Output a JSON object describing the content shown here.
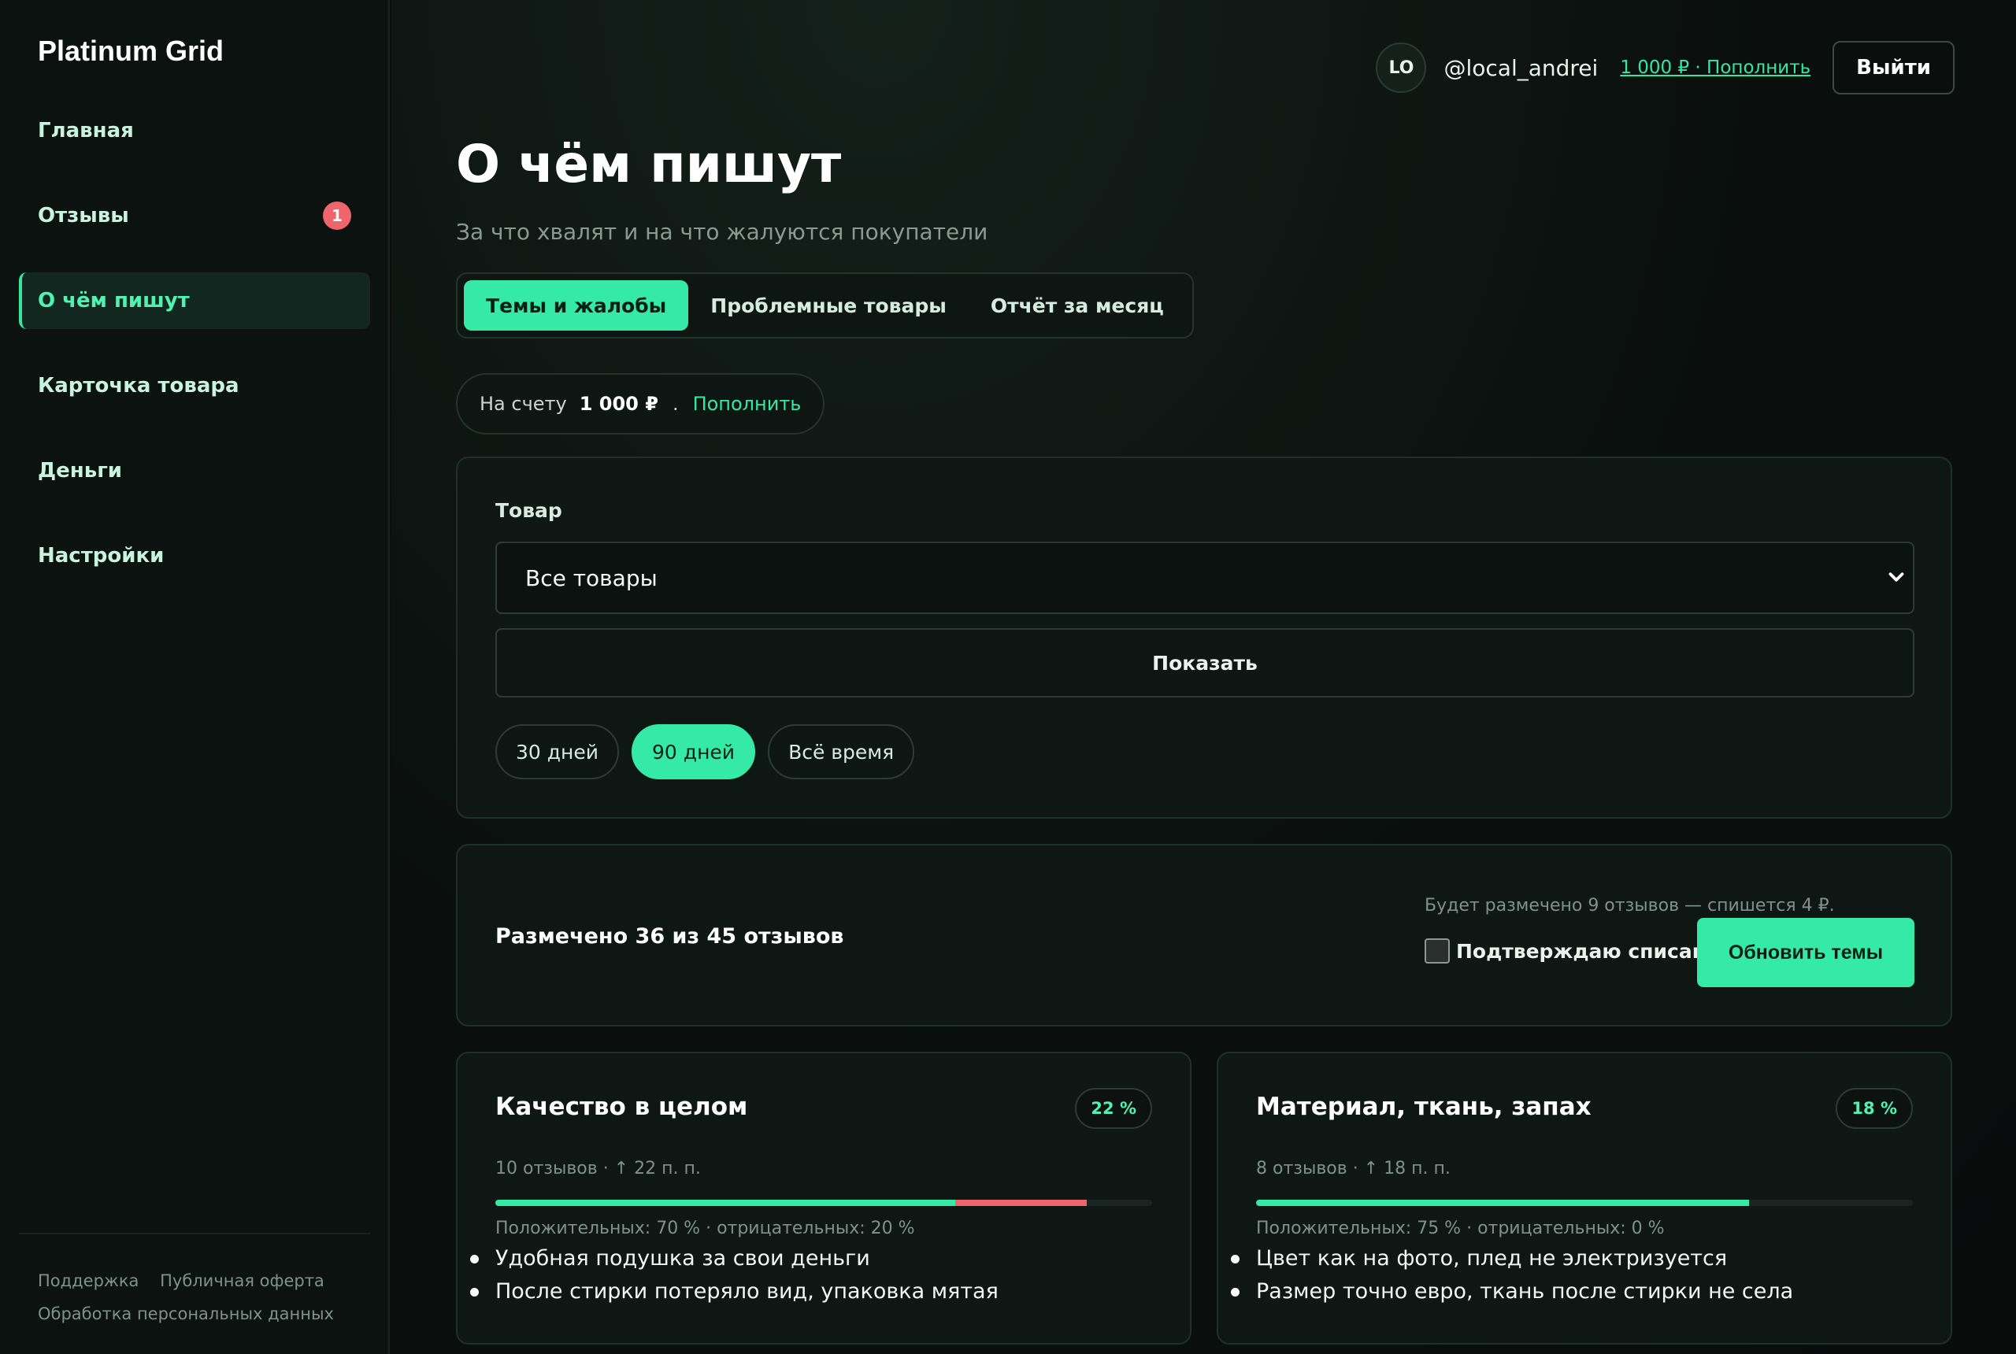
{
  "brand": "Platinum Grid",
  "nav": [
    {
      "label": "Главная",
      "badge": null,
      "active": false
    },
    {
      "label": "Отзывы",
      "badge": "1",
      "active": false
    },
    {
      "label": "О чём пишут",
      "badge": null,
      "active": true
    },
    {
      "label": "Карточка товара",
      "badge": null,
      "active": false
    },
    {
      "label": "Деньги",
      "badge": null,
      "active": false
    },
    {
      "label": "Настройки",
      "badge": null,
      "active": false
    }
  ],
  "footer": {
    "support": "Поддержка",
    "offer": "Публичная оферта",
    "privacy": "Обработка персональных данных"
  },
  "topbar": {
    "avatar_initials": "LO",
    "username": "@local_andrei",
    "balance_link": "1 000 ₽ · Пополнить",
    "logout": "Выйти"
  },
  "page": {
    "title": "О чём пишут",
    "subtitle": "За что хвалят и на что жалуются покупатели"
  },
  "tabs": [
    {
      "label": "Темы и жалобы",
      "active": true
    },
    {
      "label": "Проблемные товары",
      "active": false
    },
    {
      "label": "Отчёт за месяц",
      "active": false
    }
  ],
  "wallet": {
    "label": "На счету",
    "amount": "1 000 ₽",
    "separator": ".",
    "topup": "Пополнить"
  },
  "filter": {
    "product_label": "Товар",
    "product_value": "Все товары",
    "show_button": "Показать",
    "periods": [
      {
        "label": "30 дней",
        "active": false
      },
      {
        "label": "90 дней",
        "active": true
      },
      {
        "label": "Всё время",
        "active": false
      }
    ]
  },
  "status": {
    "text": "Размечено 36 из 45 отзывов",
    "note": "Будет размечено 9 отзывов — спишется 4 ₽.",
    "confirm_label": "Подтверждаю списание",
    "confirm_checked": false,
    "update_button": "Обновить темы"
  },
  "topics": [
    {
      "title": "Качество в целом",
      "share": "22 %",
      "meta": "10 отзывов · ↑ 22 п. п.",
      "positive": 70,
      "negative": 20,
      "split": "Положительных: 70 % · отрицательных: 20 %",
      "quotes": [
        "Удобная подушка за свои деньги",
        "После стирки потеряло вид, упаковка мятая"
      ]
    },
    {
      "title": "Материал, ткань, запах",
      "share": "18 %",
      "meta": "8 отзывов · ↑ 18 п. п.",
      "positive": 75,
      "negative": 0,
      "split": "Положительных: 75 % · отрицательных: 0 %",
      "quotes": [
        "Цвет как на фото, плед не электризуется",
        "Размер точно евро, ткань после стирки не села"
      ]
    }
  ],
  "colors": {
    "accent": "#35eaa7",
    "negative": "#f0646b",
    "background": "#0a0f0d"
  }
}
